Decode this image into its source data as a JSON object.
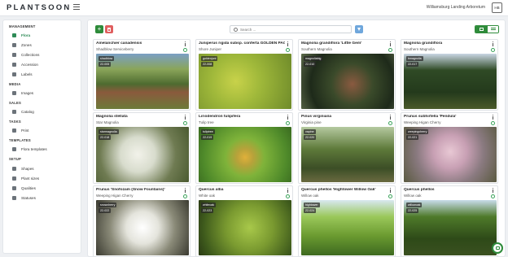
{
  "app": {
    "logo": "PLANTSOON",
    "org_name": "Williamsburg Landing Arboretum",
    "user_initials": "HB"
  },
  "sidebar": {
    "sections": [
      {
        "title": "MANAGEMENT",
        "items": [
          {
            "label": "Flora",
            "icon": "flora-icon",
            "active": true
          },
          {
            "label": "Zones",
            "icon": "zones-icon"
          },
          {
            "label": "Collections",
            "icon": "collections-icon"
          },
          {
            "label": "Accession",
            "icon": "accession-icon"
          },
          {
            "label": "Labels",
            "icon": "labels-icon"
          }
        ]
      },
      {
        "title": "MEDIA",
        "items": [
          {
            "label": "Images",
            "icon": "images-icon"
          }
        ]
      },
      {
        "title": "SALES",
        "items": [
          {
            "label": "Catalog",
            "icon": "catalog-icon"
          }
        ]
      },
      {
        "title": "TASKS",
        "items": [
          {
            "label": "Print",
            "icon": "print-icon"
          }
        ]
      },
      {
        "title": "TEMPLATES",
        "items": [
          {
            "label": "Flora templates",
            "icon": "flora-templates-icon"
          }
        ]
      },
      {
        "title": "SETUP",
        "items": [
          {
            "label": "Shapes",
            "icon": "shapes-icon"
          },
          {
            "label": "Plant sizes",
            "icon": "plant-sizes-icon"
          },
          {
            "label": "Qualities",
            "icon": "qualities-icon"
          },
          {
            "label": "Statuses",
            "icon": "statuses-icon"
          }
        ]
      }
    ]
  },
  "toolbar": {
    "add_label": "+",
    "search_placeholder": "Search ..."
  },
  "cards": [
    {
      "scientific": "Amelanchier canadensis",
      "common": "Shadblow Serviceberry",
      "tag": "shadblow",
      "code": "22-005"
    },
    {
      "scientific": "Juniperus rigida subsp. conferta GOLDEN PACIFIC™",
      "common": "Shore Juniper",
      "tag": "goldenjuni",
      "code": "22-008"
    },
    {
      "scientific": "Magnolia grandiflora 'Little Gem'",
      "common": "Southern Magnolia",
      "tag": "magnoliabig",
      "code": "22-010"
    },
    {
      "scientific": "Magnolia grandiflora",
      "common": "Southern Magnolia",
      "tag": "bmagnolia",
      "code": "22-017"
    },
    {
      "scientific": "Magnolia stellata",
      "common": "Star Magnolia",
      "tag": "starmagnolia",
      "code": "22-018"
    },
    {
      "scientific": "Liriodendron tulipifera",
      "common": "Tulip tree",
      "tag": "tuliptree",
      "code": "22-019"
    },
    {
      "scientific": "Pinus virginiana",
      "common": "Virginia pine",
      "tag": "vapine",
      "code": "22-020"
    },
    {
      "scientific": "Prunus subhirtella 'Pendula'",
      "common": "Weeping Higan Cherry",
      "tag": "weepingcherry",
      "code": "22-021"
    },
    {
      "scientific": "Prunus 'Snofozam (Snow Fountains)'",
      "common": "Weeping Higan Cherry",
      "tag": "snowcherry",
      "code": "22-022"
    },
    {
      "scientific": "Quercus alba",
      "common": "White oak",
      "tag": "whiteoak",
      "code": "22-023"
    },
    {
      "scientific": "Quercus phellos 'Hightower Willow Oak'",
      "common": "Willow oak",
      "tag": "hightower",
      "code": "22-024"
    },
    {
      "scientific": "Quercus phellos",
      "common": "Willow oak",
      "tag": "willowoak",
      "code": "22-025"
    }
  ]
}
